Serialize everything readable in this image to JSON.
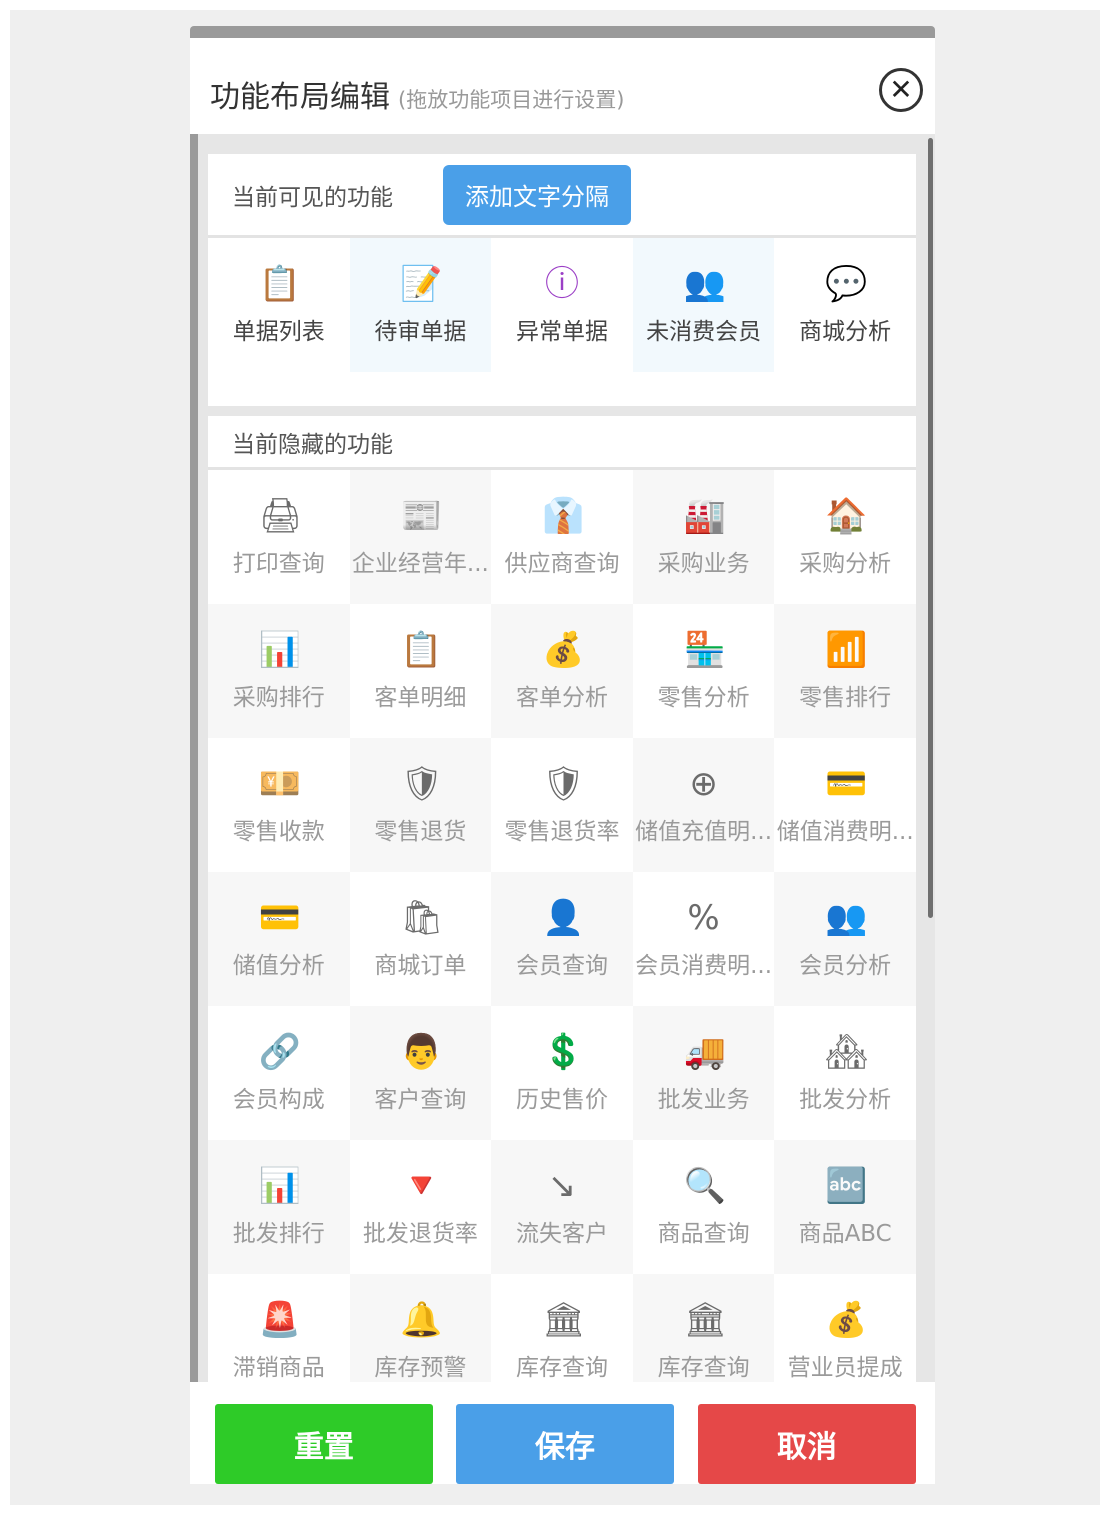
{
  "dialog": {
    "title": "功能布局编辑",
    "subtitle": "(拖放功能项目进行设置)"
  },
  "visible_section": {
    "title": "当前可见的功能",
    "add_button": "添加文字分隔",
    "items": [
      {
        "label": "单据列表",
        "icon": "📋",
        "icon_name": "document-list-icon",
        "color": "#3d9be0"
      },
      {
        "label": "待审单据",
        "icon": "📝",
        "icon_name": "pending-doc-icon",
        "color": "#e8813a"
      },
      {
        "label": "异常单据",
        "icon": "ⓘ",
        "icon_name": "info-icon",
        "color": "#9b3fc6"
      },
      {
        "label": "未消费会员",
        "icon": "👥",
        "icon_name": "members-icon",
        "color": "#4aa43a"
      },
      {
        "label": "商城分析",
        "icon": "💬",
        "icon_name": "wechat-icon",
        "color": "#e25a5a"
      }
    ]
  },
  "hidden_section": {
    "title": "当前隐藏的功能",
    "items": [
      {
        "label": "打印查询",
        "icon": "🖨",
        "icon_name": "printer-icon"
      },
      {
        "label": "企业经营年...",
        "icon": "📰",
        "icon_name": "report-icon"
      },
      {
        "label": "供应商查询",
        "icon": "👔",
        "icon_name": "supplier-icon"
      },
      {
        "label": "采购业务",
        "icon": "🏭",
        "icon_name": "warehouse-icon"
      },
      {
        "label": "采购分析",
        "icon": "🏠",
        "icon_name": "house-analysis-icon"
      },
      {
        "label": "采购排行",
        "icon": "📊",
        "icon_name": "bar-ranking-icon"
      },
      {
        "label": "客单明细",
        "icon": "📋",
        "icon_name": "clipboard-check-icon"
      },
      {
        "label": "客单分析",
        "icon": "💰",
        "icon_name": "money-bag-icon"
      },
      {
        "label": "零售分析",
        "icon": "🏪",
        "icon_name": "shop-icon"
      },
      {
        "label": "零售排行",
        "icon": "📶",
        "icon_name": "retail-ranking-icon"
      },
      {
        "label": "零售收款",
        "icon": "💴",
        "icon_name": "yen-hand-icon"
      },
      {
        "label": "零售退货",
        "icon": "🛡",
        "icon_name": "return-shield-icon"
      },
      {
        "label": "零售退货率",
        "icon": "🛡",
        "icon_name": "return-rate-icon"
      },
      {
        "label": "储值充值明...",
        "icon": "⊕",
        "icon_name": "recharge-icon"
      },
      {
        "label": "储值消费明...",
        "icon": "💳",
        "icon_name": "card-coin-icon"
      },
      {
        "label": "储值分析",
        "icon": "💳",
        "icon_name": "card-icon"
      },
      {
        "label": "商城订单",
        "icon": "🛍",
        "icon_name": "shopping-bag-icon"
      },
      {
        "label": "会员查询",
        "icon": "👤",
        "icon_name": "member-search-icon"
      },
      {
        "label": "会员消费明...",
        "icon": "%",
        "icon_name": "percent-icon"
      },
      {
        "label": "会员分析",
        "icon": "👥",
        "icon_name": "member-analysis-icon"
      },
      {
        "label": "会员构成",
        "icon": "🔗",
        "icon_name": "org-structure-icon"
      },
      {
        "label": "客户查询",
        "icon": "👨",
        "icon_name": "customer-icon"
      },
      {
        "label": "历史售价",
        "icon": "💲",
        "icon_name": "price-history-icon"
      },
      {
        "label": "批发业务",
        "icon": "🚚",
        "icon_name": "wholesale-icon"
      },
      {
        "label": "批发分析",
        "icon": "🏘",
        "icon_name": "wholesale-analysis-icon"
      },
      {
        "label": "批发排行",
        "icon": "📊",
        "icon_name": "wholesale-ranking-icon"
      },
      {
        "label": "批发退货率",
        "icon": "🔻",
        "icon_name": "wholesale-return-icon"
      },
      {
        "label": "流失客户",
        "icon": "↘",
        "icon_name": "lost-customer-icon"
      },
      {
        "label": "商品查询",
        "icon": "🔍",
        "icon_name": "product-search-icon"
      },
      {
        "label": "商品ABC",
        "icon": "🔤",
        "icon_name": "abc-blocks-icon"
      },
      {
        "label": "滞销商品",
        "icon": "🚨",
        "icon_name": "alarm-icon"
      },
      {
        "label": "库存预警",
        "icon": "🔔",
        "icon_name": "bell-icon"
      },
      {
        "label": "库存查询",
        "icon": "🏛",
        "icon_name": "inventory-icon"
      },
      {
        "label": "库存查询",
        "icon": "🏛",
        "icon_name": "inventory-icon-2"
      },
      {
        "label": "营业员提成",
        "icon": "💰",
        "icon_name": "commission-icon"
      }
    ]
  },
  "footer": {
    "reset": "重置",
    "save": "保存",
    "cancel": "取消"
  }
}
